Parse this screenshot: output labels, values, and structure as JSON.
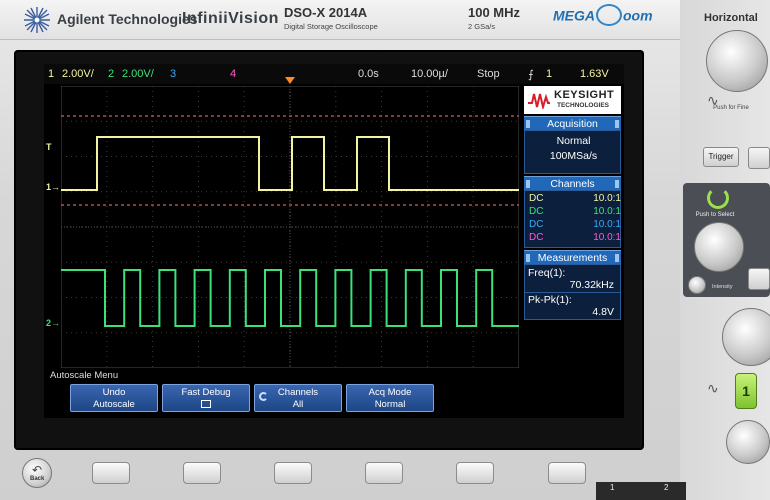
{
  "header": {
    "brand": "Agilent Technologies",
    "product_line": "InfiniiVision",
    "model": "DSO-X 2014A",
    "model_subtitle": "Digital Storage Oscilloscope",
    "bandwidth": "100 MHz",
    "sample_rate_spec": "2 GSa/s",
    "megazoom_prefix": "MEGA",
    "megazoom_suffix": "oom"
  },
  "status_bar": {
    "ch1_num": "1",
    "ch1_scale": "2.00V/",
    "ch2_num": "2",
    "ch2_scale": "2.00V/",
    "ch3_num": "3",
    "ch4_num": "4",
    "time_offset": "0.0s",
    "time_scale": "10.00µ/",
    "run_state": "Stop",
    "trigger_symbol": "⨍",
    "trigger_source": "1",
    "trigger_level": "1.63V"
  },
  "markers": {
    "trigger_marker": "T",
    "ch1_marker": "1→",
    "ch2_marker": "2→"
  },
  "panel": {
    "logo_line1": "KEYSIGHT",
    "logo_line2": "TECHNOLOGIES",
    "acquisition_title": "Acquisition",
    "acquisition_mode": "Normal",
    "acquisition_rate": "100MSa/s",
    "channels_title": "Channels",
    "channels": [
      {
        "coupling": "DC",
        "probe": "10.0:1"
      },
      {
        "coupling": "DC",
        "probe": "10.0:1"
      },
      {
        "coupling": "DC",
        "probe": "10.0:1"
      },
      {
        "coupling": "DC",
        "probe": "10.0:1"
      }
    ],
    "measurements_title": "Measurements",
    "freq_label": "Freq(1):",
    "freq_value": "70.32kHz",
    "pkpk_label": "Pk-Pk(1):",
    "pkpk_value": "4.8V"
  },
  "softkey_menu": {
    "title": "Autoscale Menu",
    "keys": [
      {
        "line1": "Undo",
        "line2": "Autoscale"
      },
      {
        "line1": "Fast Debug",
        "line2": ""
      },
      {
        "line1": "Channels",
        "line2": "All"
      },
      {
        "line1": "Acq Mode",
        "line2": "Normal"
      }
    ]
  },
  "front_panel": {
    "horizontal_label": "Horizontal",
    "push_for_fine": "Push for Fine",
    "trigger_button": "Trigger",
    "push_to_select": "Push to Select",
    "intensity": "Intensity",
    "channel_button": "1",
    "back_label": "Back",
    "bottom_num1": "1",
    "bottom_num2": "2"
  },
  "colors": {
    "ch1": "#f4f4a0",
    "ch2": "#3de07a",
    "ch3": "#39a9ff",
    "ch4": "#ff5ad0",
    "softkey": "#1f4a8c",
    "panel_title": "#2168b8"
  }
}
